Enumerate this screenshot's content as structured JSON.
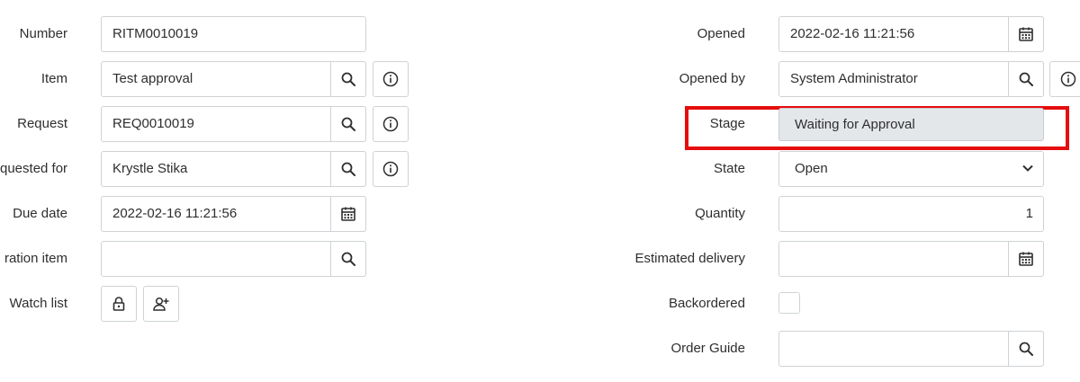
{
  "left": {
    "number": {
      "label": "Number",
      "value": "RITM0010019"
    },
    "item": {
      "label": "Item",
      "value": "Test approval"
    },
    "request": {
      "label": "Request",
      "value": "REQ0010019"
    },
    "requested_for": {
      "label": "quested for",
      "value": "Krystle Stika"
    },
    "due_date": {
      "label": "Due date",
      "value": "2022-02-16 11:21:56"
    },
    "configuration_item": {
      "label": "ration item",
      "value": ""
    },
    "watch_list": {
      "label": "Watch list"
    }
  },
  "right": {
    "opened": {
      "label": "Opened",
      "value": "2022-02-16 11:21:56"
    },
    "opened_by": {
      "label": "Opened by",
      "value": "System Administrator"
    },
    "stage": {
      "label": "Stage",
      "value": "Waiting for Approval"
    },
    "state": {
      "label": "State",
      "value": "Open",
      "options": [
        "Open"
      ]
    },
    "quantity": {
      "label": "Quantity",
      "value": "1"
    },
    "estimated_delivery": {
      "label": "Estimated delivery",
      "value": ""
    },
    "backordered": {
      "label": "Backordered",
      "checked": false
    },
    "order_guide": {
      "label": "Order Guide",
      "value": ""
    }
  },
  "icons": {
    "search": "search-icon",
    "info": "info-icon",
    "calendar": "calendar-icon",
    "lock": "lock-icon",
    "add_user": "add-user-icon",
    "chevron": "chevron-down-icon"
  },
  "colors": {
    "highlight": "#e50d0d",
    "readonly_bg": "#e4e7ea",
    "border": "#cfd3d6"
  }
}
